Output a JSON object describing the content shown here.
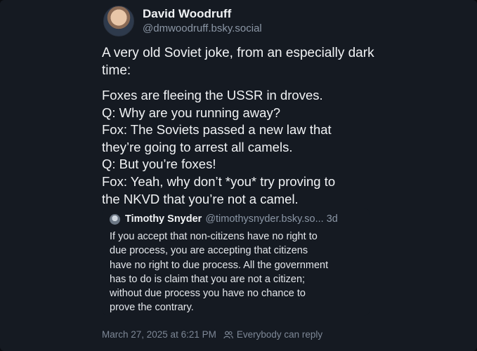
{
  "author": {
    "name": "David Woodruff",
    "handle": "@dmwoodruff.bsky.social",
    "avatar_icon": "user-avatar"
  },
  "post": {
    "intro": "A very old Soviet joke, from an especially dark time:",
    "joke_lines": [
      "Foxes are fleeing the USSR in droves.",
      "Q: Why are you running away?",
      "Fox: The Soviets passed a new law that",
      "they’re going to arrest all camels.",
      "Q: But you’re foxes!",
      "Fox: Yeah, why don’t *you* try proving to",
      "the NKVD that you’re not a camel."
    ]
  },
  "quote": {
    "name": "Timothy Snyder",
    "handle_time": "@timothysnyder.bsky.so... 3d",
    "lines": [
      "If you accept that non-citizens have no right to",
      "due process, you are accepting that citizens",
      "have no right to due process. All the government",
      "has to do is claim that you are not a citizen;",
      "without due process you have no chance to",
      "prove the contrary."
    ]
  },
  "footer": {
    "timestamp": "March 27, 2025 at 6:21 PM",
    "reply_setting": "Everybody can reply",
    "reply_icon": "people-icon"
  }
}
